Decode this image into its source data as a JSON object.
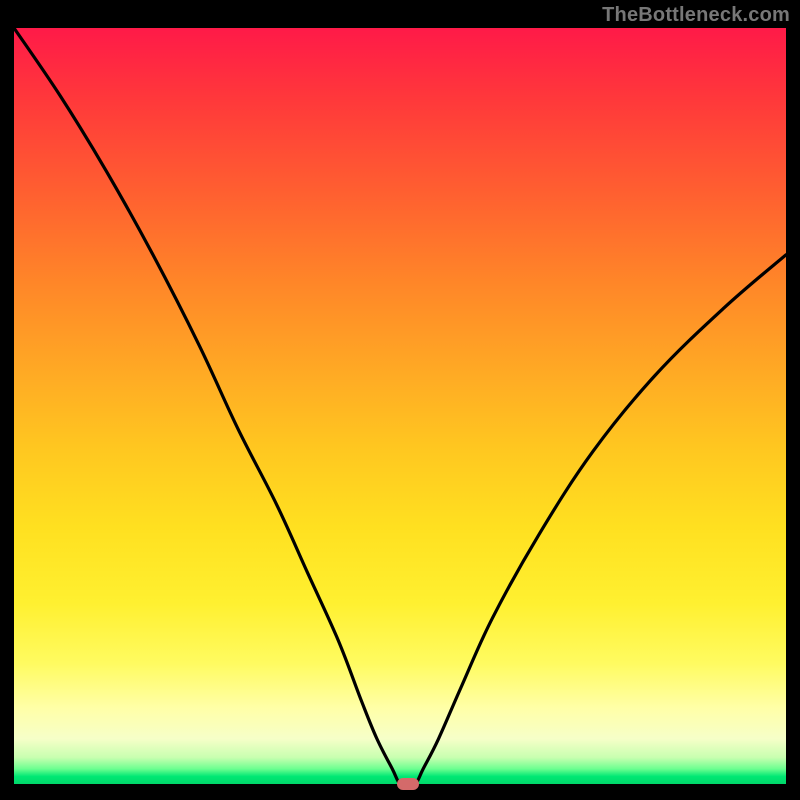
{
  "watermark": "TheBottleneck.com",
  "colors": {
    "curve_stroke": "#000000",
    "marker_fill": "#d46a6a",
    "frame_bg": "#000000"
  },
  "chart_data": {
    "type": "line",
    "title": "",
    "xlabel": "",
    "ylabel": "",
    "xlim": [
      0,
      100
    ],
    "ylim": [
      0,
      100
    ],
    "grid": false,
    "legend": false,
    "series": [
      {
        "name": "bottleneck-curve",
        "x": [
          0,
          6,
          12,
          18,
          24,
          29,
          34,
          38,
          42,
          45,
          47,
          49,
          50,
          51,
          52,
          53,
          55,
          58,
          62,
          68,
          75,
          83,
          92,
          100
        ],
        "values": [
          100,
          91,
          81,
          70,
          58,
          47,
          37,
          28,
          19,
          11,
          6,
          2,
          0,
          0,
          0,
          2,
          6,
          13,
          22,
          33,
          44,
          54,
          63,
          70
        ]
      }
    ],
    "annotations": [
      {
        "name": "optimal-marker",
        "x": 51,
        "y": 0,
        "shape": "pill",
        "color": "#d46a6a"
      }
    ]
  }
}
